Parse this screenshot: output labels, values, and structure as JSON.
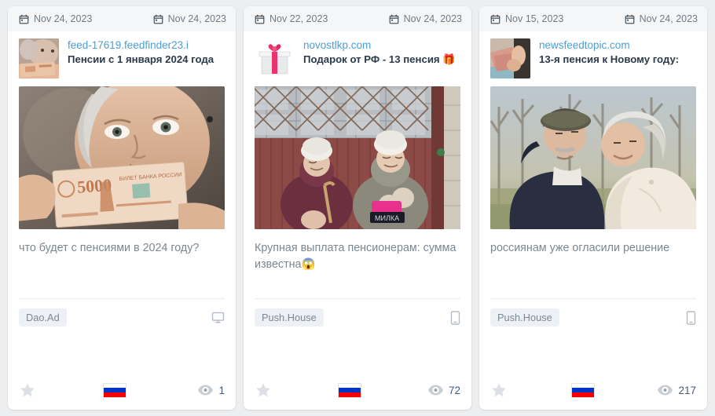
{
  "cards": [
    {
      "date_created": "Nov 24, 2023",
      "date_updated": "Nov 24, 2023",
      "domain": "feed-17619.feedfinder23.i",
      "ad_title": "Пенсии с 1 января 2024 года",
      "body_text": "что будет с пенсиями в 2024 году?",
      "source": "Dao.Ad",
      "device": "desktop-icon",
      "views": "1",
      "country": "Russia",
      "thumb_icon": "elderly-woman-with-banknote-thumbnail",
      "creative_alt": "elderly-woman-holding-5000-ruble-banknote"
    },
    {
      "date_created": "Nov 22, 2023",
      "date_updated": "Nov 24, 2023",
      "domain": "novostlkp.com",
      "ad_title": "Подарок от РФ - 13 пенсия 🎁",
      "body_text": "Крупная выплата пенсионерам: сумма известна😱",
      "source": "Push.House",
      "device": "mobile-icon",
      "views": "72",
      "country": "Russia",
      "thumb_icon": "gift-box-thumbnail",
      "creative_alt": "two-elderly-women-sitting-on-bench"
    },
    {
      "date_created": "Nov 15, 2023",
      "date_updated": "Nov 24, 2023",
      "domain": "newsfeedtopic.com",
      "ad_title": "13-я пенсия к Новому году:",
      "body_text": "россиянам уже огласили решение",
      "source": "Push.House",
      "device": "mobile-icon",
      "views": "217",
      "country": "Russia",
      "thumb_icon": "hands-holding-ruble-banknotes-thumbnail",
      "creative_alt": "elderly-couple-embracing-outdoors"
    }
  ],
  "colors": {
    "page_background": "#eceef0",
    "card_background": "#ffffff",
    "date_strip_background": "#f5f6f8",
    "domain_link": "#4a9fd4",
    "ad_title": "#2b3a4a",
    "body_text": "#7a8791",
    "chip_background": "#edf1f6",
    "chip_text": "#7b8894",
    "views_text": "#46597a",
    "star_inactive": "#dcdfe3",
    "flag_white": "#ffffff",
    "flag_blue": "#0036c8",
    "flag_red": "#f40000"
  }
}
